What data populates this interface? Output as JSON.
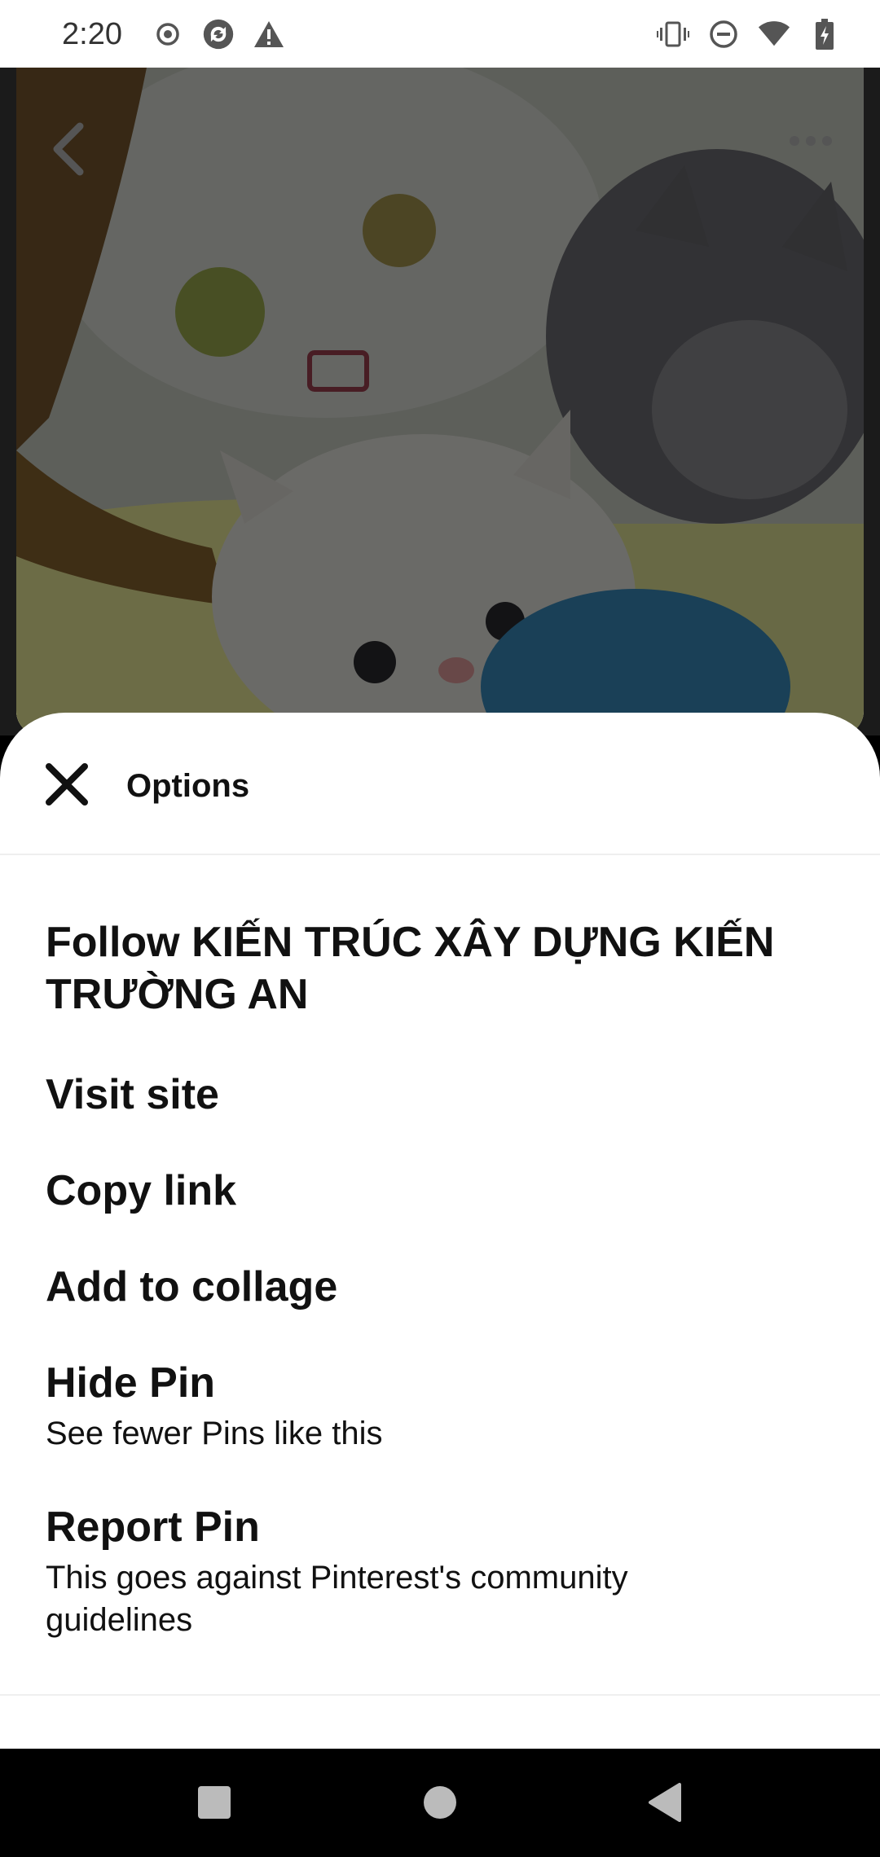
{
  "status_bar": {
    "time": "2:20",
    "left_icons": [
      "record-icon",
      "sync-icon",
      "warning-icon"
    ],
    "right_icons": [
      "vibrate-icon",
      "do-not-disturb-icon",
      "wifi-icon",
      "battery-icon"
    ]
  },
  "background": {
    "image": "kittens-photo",
    "back_icon": "chevron-left-icon",
    "more_icon": "more-horizontal-icon"
  },
  "sheet": {
    "title": "Options",
    "close_icon": "close-icon",
    "items": [
      {
        "label": "Follow KIẾN TRÚC XÂY DỰNG KIẾN TRƯỜNG AN",
        "sub": ""
      },
      {
        "label": "Visit site",
        "sub": ""
      },
      {
        "label": "Copy link",
        "sub": ""
      },
      {
        "label": "Add to collage",
        "sub": ""
      },
      {
        "label": "Hide Pin",
        "sub": "See fewer Pins like this"
      },
      {
        "label": "Report Pin",
        "sub": "This goes against Pinterest's community guidelines"
      }
    ]
  },
  "nav_bar": {
    "icons": [
      "recents-icon",
      "home-icon",
      "back-icon"
    ]
  },
  "colors": {
    "sheet_bg": "#ffffff",
    "text": "#111111",
    "nav_bg": "#000000",
    "status_bg": "#ffffff"
  }
}
